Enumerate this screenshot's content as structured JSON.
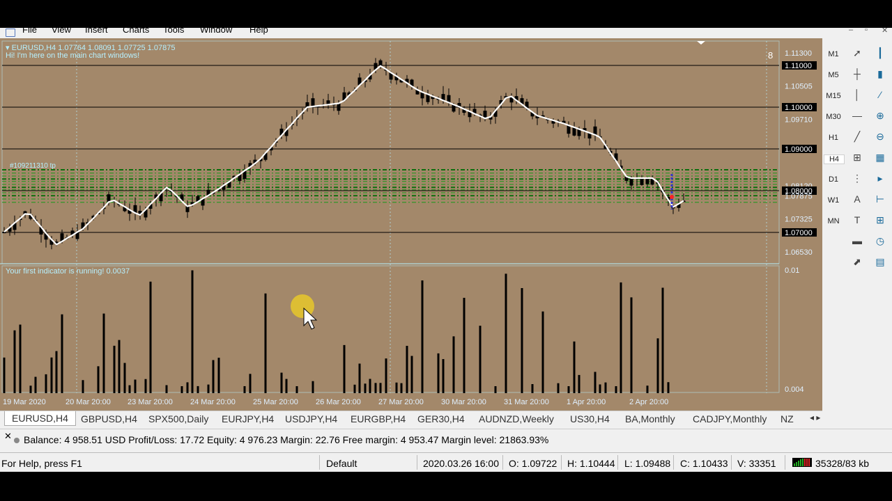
{
  "menu": [
    "File",
    "View",
    "Insert",
    "Charts",
    "Tools",
    "Window",
    "Help"
  ],
  "chart": {
    "symbol_info": "EURUSD,H4  1.07764 1.08091 1.07725 1.07875",
    "message": "Hi! I'm here on the main chart windows!",
    "indicator_label": "Your first indicator is running! 0.0037",
    "corner_number": "8",
    "trade_label": "#109211310 tp",
    "price_levels": [
      "1.11300",
      "1.11000",
      "1.10505",
      "1.10000",
      "1.09710",
      "1.09000",
      "1.08120",
      "1.08000",
      "1.07875",
      "1.07325",
      "1.07000",
      "1.06530"
    ],
    "indicator_levels": [
      "0.01",
      "0.004"
    ],
    "time_labels": [
      "19 Mar 2020",
      "20 Mar 20:00",
      "23 Mar 20:00",
      "24 Mar 20:00",
      "25 Mar 20:00",
      "26 Mar 20:00",
      "27 Mar 20:00",
      "30 Mar 20:00",
      "31 Mar 20:00",
      "1 Apr 20:00",
      "2 Apr 20:00"
    ],
    "colors": {
      "background": "#a3886a",
      "candle": "#000000",
      "line": "#ffffff",
      "grid": "#b6f0ff",
      "level_line": "#000000",
      "dash_level": "#1a9a1a"
    }
  },
  "timeframes": [
    "M1",
    "M5",
    "M15",
    "M30",
    "H1",
    "H4",
    "D1",
    "W1",
    "MN"
  ],
  "active_timeframe": "H4",
  "tools": [
    "cursor-icon",
    "crosshair-icon",
    "vertical-line-icon",
    "horizontal-line-icon",
    "trendline-icon",
    "channel-icon",
    "fibonacci-icon",
    "text-icon",
    "label-icon",
    "rectangle-icon",
    "arrow-icon"
  ],
  "tools2": [
    "bar-chart-icon",
    "candle-chart-icon",
    "line-chart-icon",
    "zoom-in-icon",
    "zoom-out-icon",
    "tile-icon",
    "autoscroll-icon",
    "chart-shift-icon",
    "indicator-add-icon",
    "period-icon",
    "template-icon"
  ],
  "tabs": [
    "EURUSD,H4",
    "GBPUSD,H4",
    "SPX500,Daily",
    "EURJPY,H4",
    "USDJPY,H4",
    "EURGBP,H4",
    "GER30,H4",
    "AUDNZD,Weekly",
    "US30,H4",
    "BA,Monthly",
    "CADJPY,Monthly",
    "NZ"
  ],
  "active_tab": "EURUSD,H4",
  "terminal": {
    "balance": "Balance: 4 958.51 USD  Profit/Loss: 17.72  Equity: 4 976.23  Margin: 22.76  Free margin: 4 953.47  Margin level: 21863.93%"
  },
  "status": {
    "help": "For Help, press F1",
    "profile": "Default",
    "datetime": "2020.03.26 16:00",
    "open": "O: 1.09722",
    "high": "H: 1.10444",
    "low": "L: 1.09488",
    "close": "C: 1.10433",
    "volume": "V: 33351",
    "traffic": "35328/83 kb"
  }
}
